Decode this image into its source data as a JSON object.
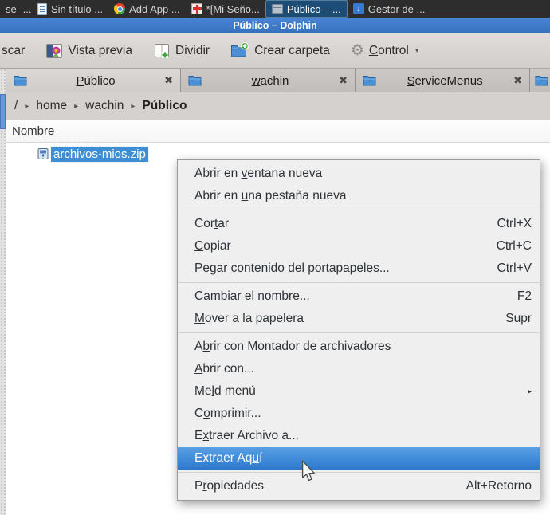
{
  "icons": {
    "close": "✖",
    "chevron": "▸",
    "submenu": "▸",
    "dropdown": "▾",
    "gear": "⚙",
    "down_arrow": "↓"
  },
  "colors": {
    "titlebar": "#3d7ccc",
    "taskbar_bg": "#2d2d2d",
    "taskbar_active": "#1d4d77",
    "selection_blue": "#3e8ed6",
    "menu_highlight": "#3c86d8",
    "menu_bg": "#efefef"
  },
  "taskbar": {
    "items": [
      {
        "label": "se -..."
      },
      {
        "label": "Sin título ...",
        "icon": "document-icon"
      },
      {
        "label": "Add  App ...",
        "icon": "chrome-icon"
      },
      {
        "label": "*[Mi Seño...",
        "icon": "image-editor-icon"
      },
      {
        "label": "Público – ...",
        "icon": "archive-icon",
        "active": true
      },
      {
        "label": "Gestor de ...",
        "icon": "download-icon"
      }
    ]
  },
  "titlebar": {
    "title": "Público – Dolphin"
  },
  "toolbar": {
    "items": [
      {
        "label": "scar"
      },
      {
        "label": "Vista previa",
        "icon": "preview-icon"
      },
      {
        "label": "Dividir",
        "icon": "split-view-icon"
      },
      {
        "label": "Crear carpeta",
        "icon": "new-folder-icon"
      },
      {
        "label": "&Control",
        "icon": "gear-icon",
        "dropdown": true
      }
    ]
  },
  "tabs": [
    {
      "label": "&Público",
      "active": true
    },
    {
      "label": "&wachin",
      "active": false
    },
    {
      "label": "&ServiceMenus",
      "active": false
    },
    {
      "label": "",
      "partial": true
    }
  ],
  "breadcrumb": {
    "segments": [
      "/",
      "home",
      "wachin",
      "Público"
    ]
  },
  "fileview": {
    "column_header": "Nombre",
    "files": [
      {
        "name": "archivos-mios.zip",
        "selected": true
      }
    ]
  },
  "context_menu": {
    "items": [
      {
        "label": "Abrir en &ventana nueva",
        "shortcut": ""
      },
      {
        "label": "Abrir en &una pestaña nueva",
        "shortcut": ""
      },
      {
        "type": "separator"
      },
      {
        "label": "Cor&tar",
        "shortcut": "Ctrl+X"
      },
      {
        "label": "&Copiar",
        "shortcut": "Ctrl+C"
      },
      {
        "label": "&Pegar contenido del portapapeles...",
        "shortcut": "Ctrl+V"
      },
      {
        "type": "separator"
      },
      {
        "label": "Cambiar &el nombre...",
        "shortcut": "F2"
      },
      {
        "label": "&Mover a la papelera",
        "shortcut": "Supr"
      },
      {
        "type": "separator"
      },
      {
        "label": "A&brir con Montador de archivadores",
        "shortcut": ""
      },
      {
        "label": "&Abrir con...",
        "shortcut": ""
      },
      {
        "label": "Me&ld menú",
        "submenu": true
      },
      {
        "label": "C&omprimir...",
        "shortcut": ""
      },
      {
        "label": "E&xtraer Archivo a...",
        "shortcut": ""
      },
      {
        "label": "Extraer Aq&uí",
        "highlighted": true
      },
      {
        "type": "separator"
      },
      {
        "label": "P&ropiedades",
        "shortcut": "Alt+Retorno"
      }
    ]
  }
}
